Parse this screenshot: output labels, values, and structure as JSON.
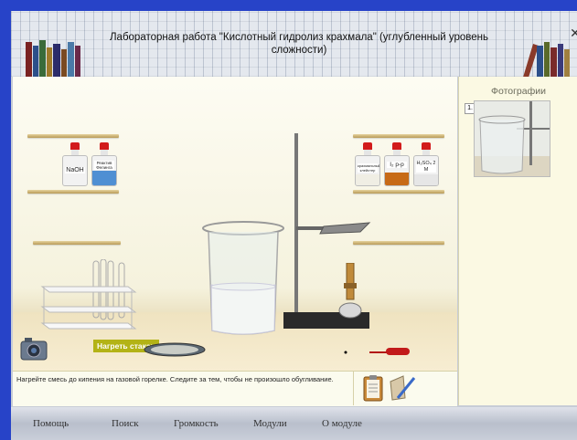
{
  "header": {
    "title": "Лабораторная работа \"Кислотный гидролиз крахмала\" (углубленный уровень сложности)"
  },
  "reagents": {
    "naoh": "NaOH",
    "fehling": "Реактив Фелинга",
    "starch": "крахмальный клейстер",
    "iodine": "I₂ р-р",
    "h2so4": "H₂SO₄ 2 M"
  },
  "action_hint": "Нагреть стакан",
  "status_text": "Нагрейте смесь до кипения на газовой горелке. Следите за тем, чтобы не произошло обугливание.",
  "photos": {
    "title": "Фотографии",
    "items": [
      "1."
    ]
  },
  "menu": {
    "items": [
      "Помощь",
      "Поиск",
      "Громкость",
      "Модули",
      "О модуле"
    ]
  },
  "colors": {
    "frame_blue": "#2743c8",
    "cap_red": "#d21b1b",
    "fehling_blue": "#4f8fd3",
    "iodine_orange": "#c76a16",
    "hint_olive": "#b3b316"
  }
}
